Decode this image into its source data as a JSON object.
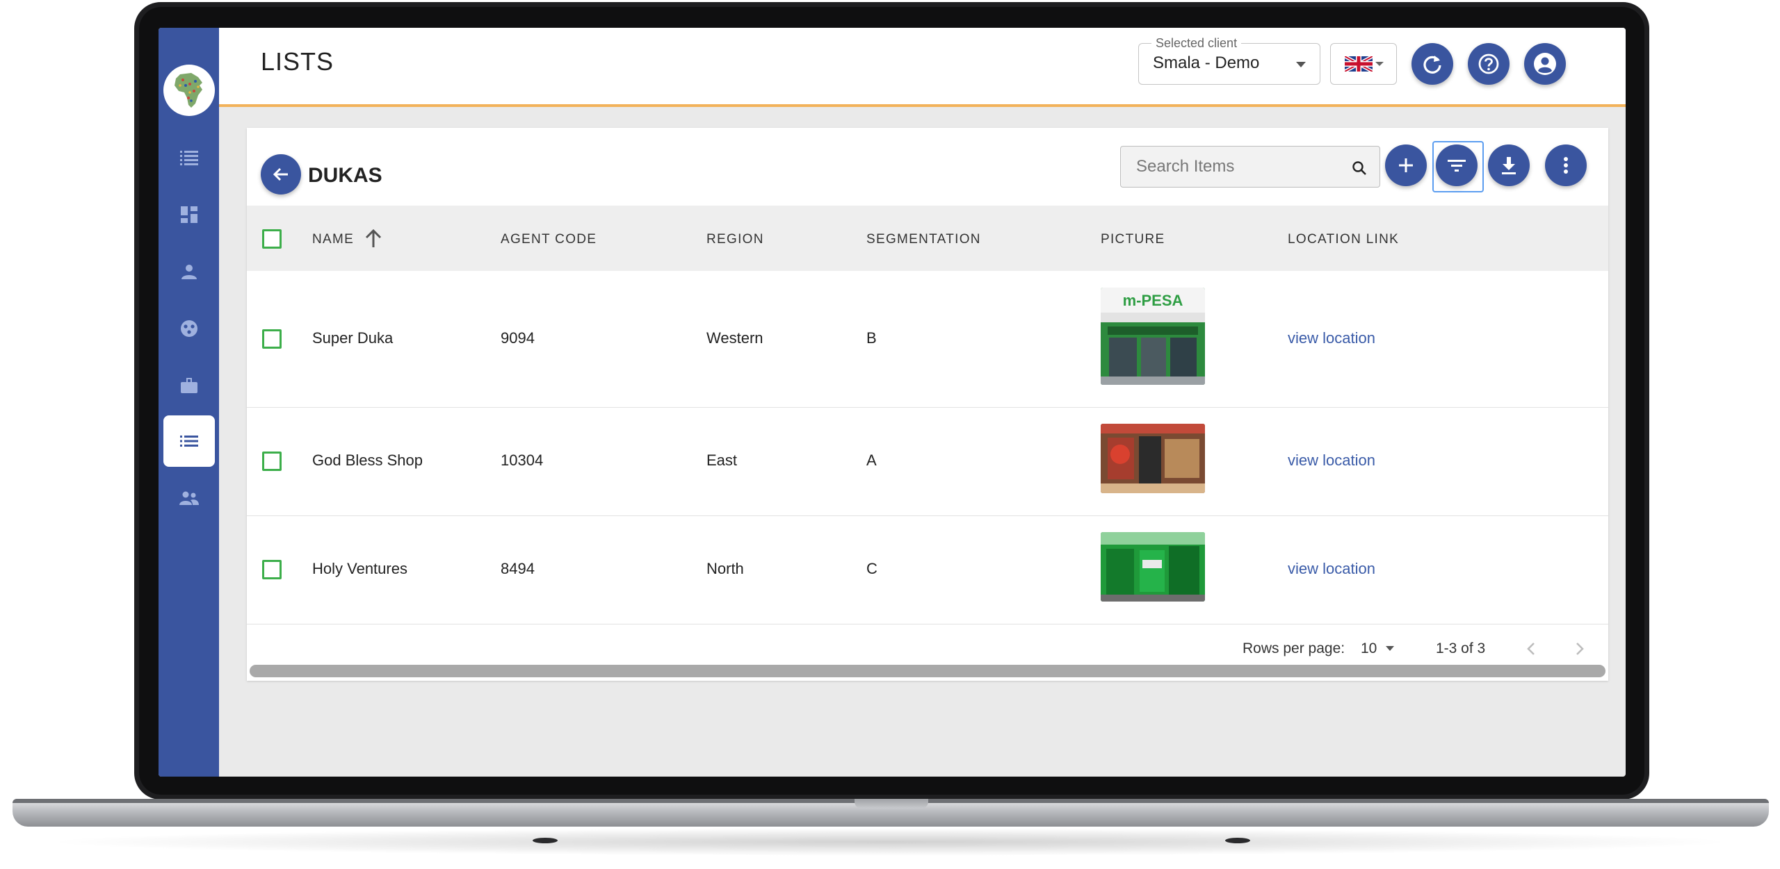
{
  "app": {
    "page_title": "LISTS"
  },
  "header": {
    "client_label": "Selected client",
    "client_value": "Smala - Demo",
    "language_icon": "uk-flag-icon",
    "buttons": [
      "refresh-icon",
      "help-icon",
      "account-icon"
    ]
  },
  "sidebar": {
    "items": [
      {
        "name": "lists-icon"
      },
      {
        "name": "dashboard-icon"
      },
      {
        "name": "person-icon"
      },
      {
        "name": "segments-icon"
      },
      {
        "name": "briefcase-icon"
      },
      {
        "name": "list-icon",
        "active": true
      },
      {
        "name": "team-icon"
      }
    ]
  },
  "list": {
    "title": "DUKAS",
    "search_placeholder": "Search Items",
    "actions": [
      "add-icon",
      "filter-icon",
      "download-icon",
      "more-icon"
    ],
    "columns": [
      "NAME",
      "AGENT CODE",
      "REGION",
      "SEGMENTATION",
      "PICTURE",
      "LOCATION LINK"
    ],
    "sort_column": "NAME",
    "rows": [
      {
        "name": "Super Duka",
        "agent_code": "9094",
        "region": "Western",
        "segmentation": "B",
        "link": "view location"
      },
      {
        "name": "God Bless Shop",
        "agent_code": "10304",
        "region": "East",
        "segmentation": "A",
        "link": "view location"
      },
      {
        "name": "Holy Ventures",
        "agent_code": "8494",
        "region": "North",
        "segmentation": "C",
        "link": "view location"
      }
    ],
    "pagination": {
      "rows_per_page_label": "Rows per page:",
      "rows_per_page": "10",
      "range": "1-3 of 3"
    }
  },
  "thumb_sign_text": "m-PESA",
  "colors": {
    "primary": "#3a559f",
    "accent": "#f2b25a",
    "checkbox": "#3cae4a",
    "link": "#3a5ba8"
  }
}
